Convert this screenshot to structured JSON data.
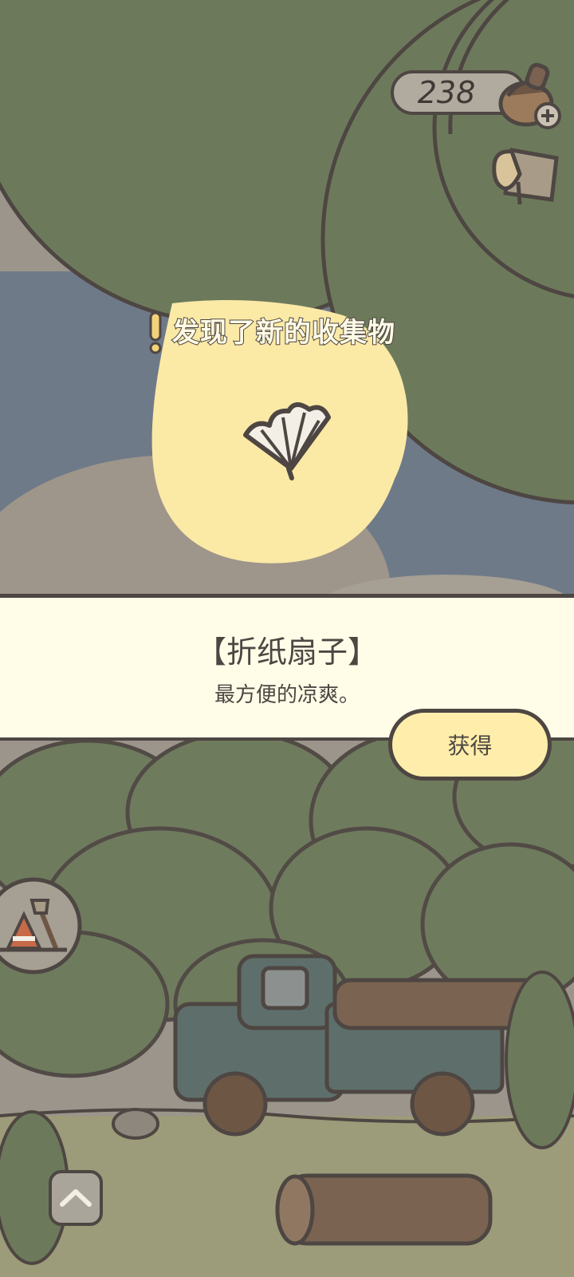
{
  "header": {
    "coin_count": "238",
    "coin_icon": "acorn-coin-add-icon",
    "bag_icon": "bag-icon"
  },
  "discovery": {
    "title": "发现了新的收集物",
    "alert_icon": "exclamation-icon",
    "item_icon": "paper-fan-icon"
  },
  "item_panel": {
    "name": "【折纸扇子】",
    "description": "最方便的凉爽。",
    "get_label": "获得"
  },
  "controls": {
    "tool_icon": "shovel-cone-icon",
    "up_icon": "chevron-up-icon"
  },
  "colors": {
    "outline": "#4e4642",
    "panel_bg": "#fffde8",
    "button_bg": "#ffeeab",
    "glow": "#fbe9a6",
    "tree_green": "#6c7a5b",
    "sky_blue": "#6f7a88"
  }
}
